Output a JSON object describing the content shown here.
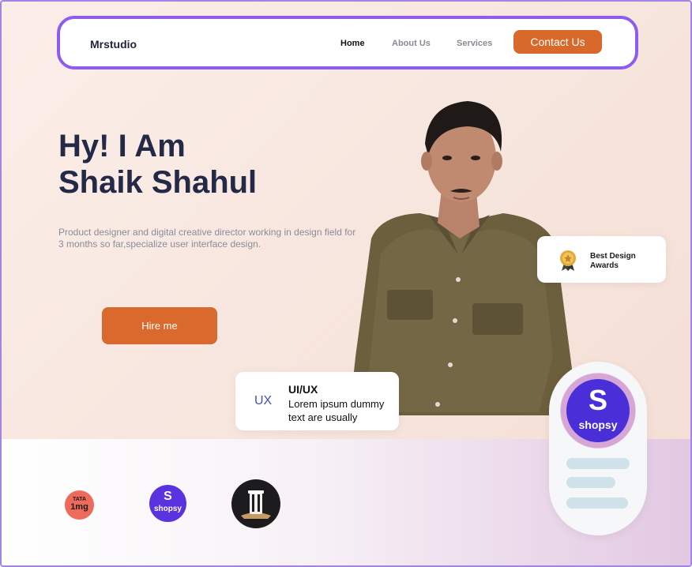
{
  "nav": {
    "brand": "Mrstudio",
    "links": [
      {
        "label": "Home",
        "active": true
      },
      {
        "label": "About Us",
        "active": false
      },
      {
        "label": "Services",
        "active": false
      }
    ],
    "cta": "Contact Us"
  },
  "hero": {
    "title_line1": "Hy! I Am",
    "title_line2": "Shaik Shahul",
    "description": "Product designer and digital creative director working in design field for 3 months so far,specialize user interface design.",
    "cta": "Hire me"
  },
  "award_card": {
    "icon": "award-medal-icon",
    "label": "Best Design Awards"
  },
  "ux_card": {
    "badge": "UX",
    "title": "UI/UX",
    "description": "Lorem ipsum dummy text are usually"
  },
  "shopsy_pill": {
    "logo_letter": "S",
    "logo_text": "shopsy"
  },
  "logos": [
    {
      "name": "tata-1mg",
      "line1": "TATA",
      "line2": "1mg"
    },
    {
      "name": "shopsy",
      "line1": "S",
      "line2": "shopsy"
    },
    {
      "name": "pillar-app",
      "icon": "pillar-icon"
    }
  ],
  "colors": {
    "accent": "#d9682b",
    "nav_border": "#8e5cf0",
    "heading": "#232946",
    "shopsy": "#5a32e0"
  }
}
